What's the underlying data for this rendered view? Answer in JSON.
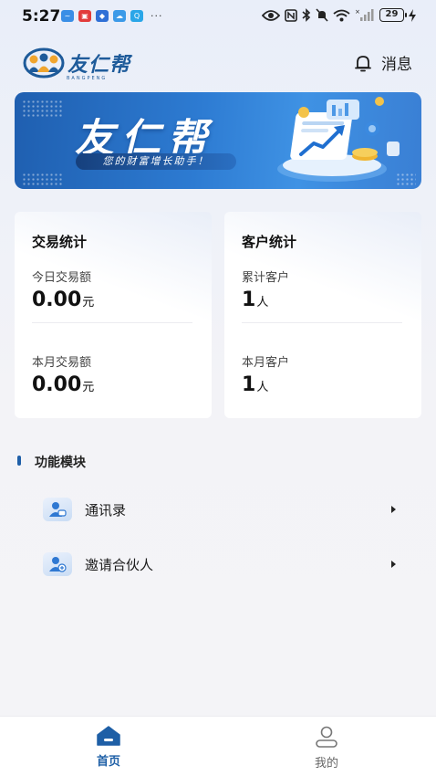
{
  "status_bar": {
    "time": "5:27",
    "dots": "···",
    "battery": "29"
  },
  "header": {
    "logo_text": "友仁帮",
    "logo_sub": "BANGPENG",
    "message_label": "消息"
  },
  "banner": {
    "title": "友仁帮",
    "slogan": "您的财富增长助手！"
  },
  "trade_stats": {
    "title": "交易统计",
    "today_label": "今日交易额",
    "today_value": "0.00",
    "today_unit": "元",
    "month_label": "本月交易额",
    "month_value": "0.00",
    "month_unit": "元"
  },
  "customer_stats": {
    "title": "客户统计",
    "total_label": "累计客户",
    "total_value": "1",
    "total_unit": "人",
    "month_label": "本月客户",
    "month_value": "1",
    "month_unit": "人"
  },
  "modules": {
    "title": "功能模块",
    "items": [
      {
        "label": "通讯录",
        "icon": "contacts-icon"
      },
      {
        "label": "邀请合伙人",
        "icon": "invite-partner-icon"
      }
    ]
  },
  "tab_bar": {
    "home_label": "首页",
    "mine_label": "我的"
  },
  "colors": {
    "brand": "#1e5fa6",
    "banner_start": "#1f5fb0",
    "banner_end": "#3f92e4",
    "text": "#1c1c1c"
  }
}
